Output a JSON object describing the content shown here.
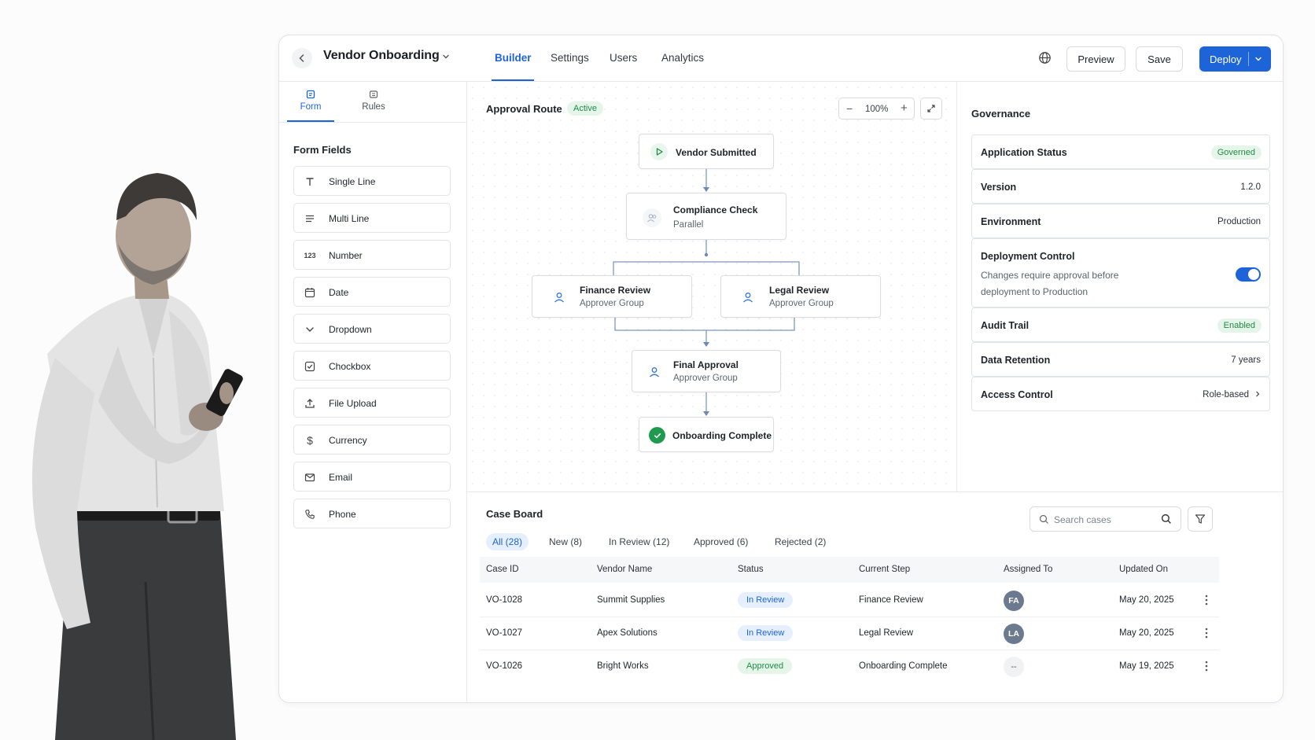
{
  "header": {
    "title": "Vendor Onboarding",
    "tabs": [
      "Builder",
      "Settings",
      "Users",
      "Analytics"
    ],
    "active_tab": "Builder",
    "preview_label": "Preview",
    "save_label": "Save",
    "deploy_label": "Deploy"
  },
  "left_panel": {
    "tabs": [
      "Form",
      "Rules"
    ],
    "section_title": "Form Fields",
    "fields": [
      {
        "label": "Single Line",
        "icon": "text-icon"
      },
      {
        "label": "Multi Line",
        "icon": "lines-icon"
      },
      {
        "label": "Number",
        "icon": "number-icon"
      },
      {
        "label": "Date",
        "icon": "calendar-icon"
      },
      {
        "label": "Dropdown",
        "icon": "chevron-down-icon"
      },
      {
        "label": "Chockbox",
        "icon": "checkbox-icon"
      },
      {
        "label": "File Upload",
        "icon": "upload-icon"
      },
      {
        "label": "Currency",
        "icon": "dollar-icon"
      },
      {
        "label": "Email",
        "icon": "mail-icon"
      },
      {
        "label": "Phone",
        "icon": "phone-icon"
      }
    ],
    "number_glyph": "123"
  },
  "canvas": {
    "title": "Approval Route",
    "status": "Active",
    "zoom": "100%",
    "nodes": {
      "start": {
        "title": "Vendor Submitted"
      },
      "compliance": {
        "title": "Compliance Check",
        "subtitle": "Parallel"
      },
      "finance": {
        "title": "Finance Review",
        "subtitle": "Approver Group"
      },
      "legal": {
        "title": "Legal Review",
        "subtitle": "Approver Group"
      },
      "final": {
        "title": "Final Approval",
        "subtitle": "Approver Group"
      },
      "end": {
        "title": "Onboarding Complete"
      }
    }
  },
  "governance": {
    "title": "Governance",
    "rows": {
      "app_status": {
        "label": "Application Status",
        "value": "Governed"
      },
      "version": {
        "label": "Version",
        "value": "1.2.0"
      },
      "environment": {
        "label": "Environment",
        "value": "Production"
      },
      "deployment": {
        "label": "Deployment Control",
        "description": "Changes require approval before deployment to Production",
        "enabled": true
      },
      "audit": {
        "label": "Audit Trail",
        "value": "Enabled"
      },
      "retention": {
        "label": "Data Retention",
        "value": "7 years"
      },
      "access": {
        "label": "Access Control",
        "value": "Role-based"
      }
    }
  },
  "case_board": {
    "title": "Case Board",
    "filters": [
      "All (28)",
      "New (8)",
      "In Review (12)",
      "Approved (6)",
      "Rejected (2)"
    ],
    "search_placeholder": "Search cases",
    "columns": [
      "Case ID",
      "Vendor Name",
      "Status",
      "Current Step",
      "Assigned To",
      "Updated On"
    ],
    "rows": [
      {
        "id": "VO-1028",
        "vendor": "Summit Supplies",
        "status": "In Review",
        "step": "Finance Review",
        "assignee": "FA",
        "updated": "May 20, 2025"
      },
      {
        "id": "VO-1027",
        "vendor": "Apex Solutions",
        "status": "In Review",
        "step": "Legal Review",
        "assignee": "LA",
        "updated": "May 20, 2025"
      },
      {
        "id": "VO-1026",
        "vendor": "Bright Works",
        "status": "Approved",
        "step": "Onboarding Complete",
        "assignee": "--",
        "updated": "May 19, 2025"
      }
    ]
  },
  "colors": {
    "accent": "#1e64d9",
    "success": "#1f8b45",
    "success_bg": "#e5f5ea",
    "info_bg": "#e6effd"
  }
}
